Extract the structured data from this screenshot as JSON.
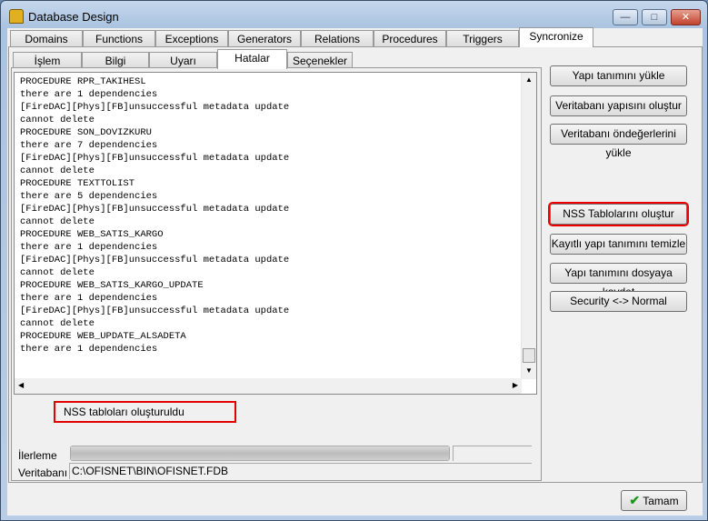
{
  "window": {
    "title": "Database Design",
    "min": "—",
    "max": "□",
    "close": "✕"
  },
  "main_tabs": [
    "Domains",
    "Functions",
    "Exceptions",
    "Generators",
    "Relations",
    "Procedures",
    "Triggers",
    "Syncronize"
  ],
  "main_active": "Syncronize",
  "sub_tabs": [
    "İşlem",
    "Bilgi",
    "Uyarı",
    "Hatalar",
    "Seçenekler"
  ],
  "sub_active": "Hatalar",
  "log_lines": [
    "PROCEDURE RPR_TAKIHESL",
    "there are 1 dependencies",
    "[FireDAC][Phys][FB]unsuccessful metadata update",
    "cannot delete",
    "PROCEDURE SON_DOVIZKURU",
    "there are 7 dependencies",
    "[FireDAC][Phys][FB]unsuccessful metadata update",
    "cannot delete",
    "PROCEDURE TEXTTOLIST",
    "there are 5 dependencies",
    "[FireDAC][Phys][FB]unsuccessful metadata update",
    "cannot delete",
    "PROCEDURE WEB_SATIS_KARGO",
    "there are 1 dependencies",
    "[FireDAC][Phys][FB]unsuccessful metadata update",
    "cannot delete",
    "PROCEDURE WEB_SATIS_KARGO_UPDATE",
    "there are 1 dependencies",
    "[FireDAC][Phys][FB]unsuccessful metadata update",
    "cannot delete",
    "PROCEDURE WEB_UPDATE_ALSADETA",
    "there are 1 dependencies"
  ],
  "status_message": "NSS tabloları oluşturuldu",
  "progress": {
    "label": "İlerleme",
    "percent": 100
  },
  "database": {
    "label": "Veritabanı",
    "value": "C:\\OFISNET\\BIN\\OFISNET.FDB"
  },
  "buttons": {
    "load_structure": "Yapı tanımını yükle",
    "create_db_structure": "Veritabanı yapısını oluştur",
    "load_defaults": "Veritabanı öndeğerlerini yükle",
    "create_nss": "NSS Tablolarını oluştur",
    "clear_saved": "Kayıtlı yapı tanımını temizle",
    "save_to_file": "Yapı tanımını dosyaya kaydet",
    "security_toggle": "Security <-> Normal",
    "ok": "Tamam"
  },
  "highlight_color": "#e00000"
}
